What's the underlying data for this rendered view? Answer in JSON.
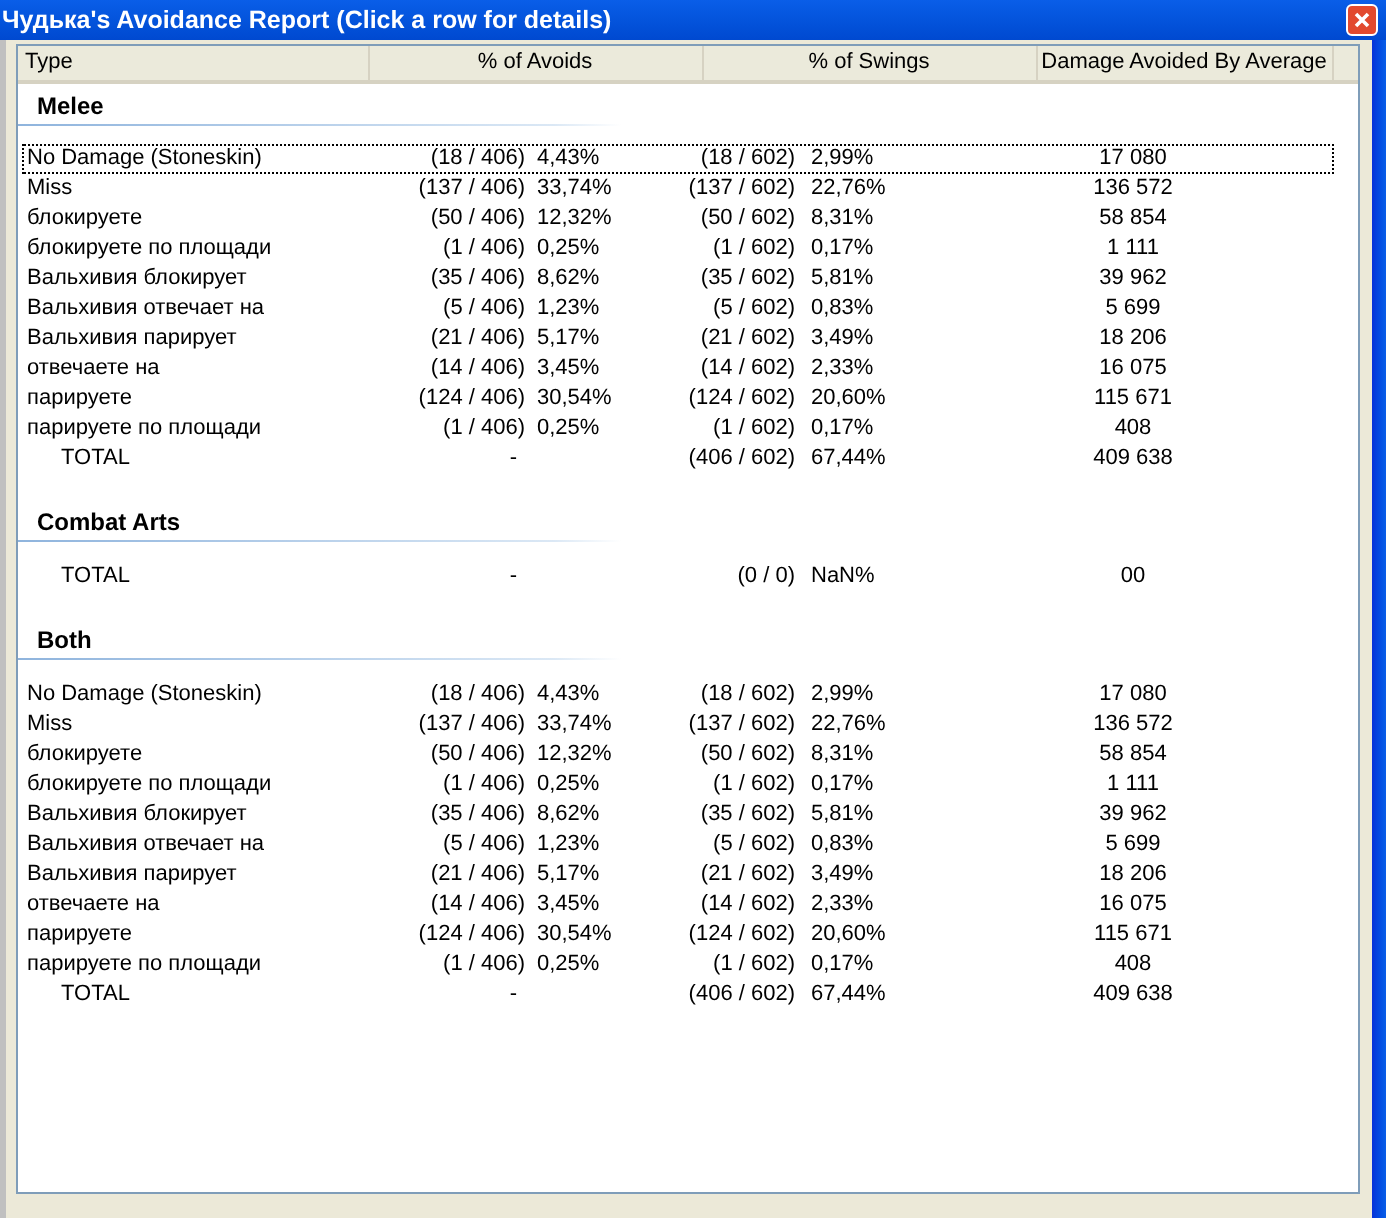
{
  "window": {
    "title": "Чудька's Avoidance Report  (Click a row for details)"
  },
  "table": {
    "columns": [
      "Type",
      "% of Avoids",
      "% of Swings",
      "Damage Avoided By Average"
    ],
    "sections": [
      {
        "title": "Melee",
        "rows": [
          {
            "kind": "item",
            "type": "No Damage (Stoneskin)",
            "avoids": {
              "fraction": "(18 / 406)",
              "percent": "4,43%"
            },
            "swings": {
              "fraction": "(18 / 602)",
              "percent": "2,99%"
            },
            "damage": "17 080",
            "focused": true
          },
          {
            "kind": "item",
            "type": "Miss",
            "avoids": {
              "fraction": "(137 / 406)",
              "percent": "33,74%"
            },
            "swings": {
              "fraction": "(137 / 602)",
              "percent": "22,76%"
            },
            "damage": "136 572",
            "focused": false
          },
          {
            "kind": "item",
            "type": "блокируете",
            "avoids": {
              "fraction": "(50 / 406)",
              "percent": "12,32%"
            },
            "swings": {
              "fraction": "(50 / 602)",
              "percent": "8,31%"
            },
            "damage": "58 854",
            "focused": false
          },
          {
            "kind": "item",
            "type": "блокируете по площади",
            "avoids": {
              "fraction": "(1 / 406)",
              "percent": "0,25%"
            },
            "swings": {
              "fraction": "(1 / 602)",
              "percent": "0,17%"
            },
            "damage": "1 111",
            "focused": false
          },
          {
            "kind": "item",
            "type": "Вальхивия блокирует",
            "avoids": {
              "fraction": "(35 / 406)",
              "percent": "8,62%"
            },
            "swings": {
              "fraction": "(35 / 602)",
              "percent": "5,81%"
            },
            "damage": "39 962",
            "focused": false
          },
          {
            "kind": "item",
            "type": "Вальхивия отвечает на",
            "avoids": {
              "fraction": "(5 / 406)",
              "percent": "1,23%"
            },
            "swings": {
              "fraction": "(5 / 602)",
              "percent": "0,83%"
            },
            "damage": "5 699",
            "focused": false
          },
          {
            "kind": "item",
            "type": "Вальхивия парирует",
            "avoids": {
              "fraction": "(21 / 406)",
              "percent": "5,17%"
            },
            "swings": {
              "fraction": "(21 / 602)",
              "percent": "3,49%"
            },
            "damage": "18 206",
            "focused": false
          },
          {
            "kind": "item",
            "type": "отвечаете на",
            "avoids": {
              "fraction": "(14 / 406)",
              "percent": "3,45%"
            },
            "swings": {
              "fraction": "(14 / 602)",
              "percent": "2,33%"
            },
            "damage": "16 075",
            "focused": false
          },
          {
            "kind": "item",
            "type": "парируете",
            "avoids": {
              "fraction": "(124 / 406)",
              "percent": "30,54%"
            },
            "swings": {
              "fraction": "(124 / 602)",
              "percent": "20,60%"
            },
            "damage": "115 671",
            "focused": false
          },
          {
            "kind": "item",
            "type": "парируете по площади",
            "avoids": {
              "fraction": "(1 / 406)",
              "percent": "0,25%"
            },
            "swings": {
              "fraction": "(1 / 602)",
              "percent": "0,17%"
            },
            "damage": "408",
            "focused": false
          },
          {
            "kind": "total",
            "type": "TOTAL",
            "avoids": {
              "fraction": "-"
            },
            "swings": {
              "fraction": "(406 / 602)",
              "percent": "67,44%"
            },
            "damage": "409 638",
            "focused": false
          }
        ]
      },
      {
        "title": "Combat Arts",
        "rows": [
          {
            "kind": "total",
            "type": "TOTAL",
            "avoids": {
              "fraction": "-"
            },
            "swings": {
              "fraction": "(0 / 0)",
              "percent": "NaN%"
            },
            "damage": "00",
            "focused": false
          }
        ]
      },
      {
        "title": "Both",
        "rows": [
          {
            "kind": "item",
            "type": "No Damage (Stoneskin)",
            "avoids": {
              "fraction": "(18 / 406)",
              "percent": "4,43%"
            },
            "swings": {
              "fraction": "(18 / 602)",
              "percent": "2,99%"
            },
            "damage": "17 080",
            "focused": false
          },
          {
            "kind": "item",
            "type": "Miss",
            "avoids": {
              "fraction": "(137 / 406)",
              "percent": "33,74%"
            },
            "swings": {
              "fraction": "(137 / 602)",
              "percent": "22,76%"
            },
            "damage": "136 572",
            "focused": false
          },
          {
            "kind": "item",
            "type": "блокируете",
            "avoids": {
              "fraction": "(50 / 406)",
              "percent": "12,32%"
            },
            "swings": {
              "fraction": "(50 / 602)",
              "percent": "8,31%"
            },
            "damage": "58 854",
            "focused": false
          },
          {
            "kind": "item",
            "type": "блокируете по площади",
            "avoids": {
              "fraction": "(1 / 406)",
              "percent": "0,25%"
            },
            "swings": {
              "fraction": "(1 / 602)",
              "percent": "0,17%"
            },
            "damage": "1 111",
            "focused": false
          },
          {
            "kind": "item",
            "type": "Вальхивия блокирует",
            "avoids": {
              "fraction": "(35 / 406)",
              "percent": "8,62%"
            },
            "swings": {
              "fraction": "(35 / 602)",
              "percent": "5,81%"
            },
            "damage": "39 962",
            "focused": false
          },
          {
            "kind": "item",
            "type": "Вальхивия отвечает на",
            "avoids": {
              "fraction": "(5 / 406)",
              "percent": "1,23%"
            },
            "swings": {
              "fraction": "(5 / 602)",
              "percent": "0,83%"
            },
            "damage": "5 699",
            "focused": false
          },
          {
            "kind": "item",
            "type": "Вальхивия парирует",
            "avoids": {
              "fraction": "(21 / 406)",
              "percent": "5,17%"
            },
            "swings": {
              "fraction": "(21 / 602)",
              "percent": "3,49%"
            },
            "damage": "18 206",
            "focused": false
          },
          {
            "kind": "item",
            "type": "отвечаете на",
            "avoids": {
              "fraction": "(14 / 406)",
              "percent": "3,45%"
            },
            "swings": {
              "fraction": "(14 / 602)",
              "percent": "2,33%"
            },
            "damage": "16 075",
            "focused": false
          },
          {
            "kind": "item",
            "type": "парируете",
            "avoids": {
              "fraction": "(124 / 406)",
              "percent": "30,54%"
            },
            "swings": {
              "fraction": "(124 / 602)",
              "percent": "20,60%"
            },
            "damage": "115 671",
            "focused": false
          },
          {
            "kind": "item",
            "type": "парируете по площади",
            "avoids": {
              "fraction": "(1 / 406)",
              "percent": "0,25%"
            },
            "swings": {
              "fraction": "(1 / 602)",
              "percent": "0,17%"
            },
            "damage": "408",
            "focused": false
          },
          {
            "kind": "total",
            "type": "TOTAL",
            "avoids": {
              "fraction": "-"
            },
            "swings": {
              "fraction": "(406 / 602)",
              "percent": "67,44%"
            },
            "damage": "409 638",
            "focused": false
          }
        ]
      }
    ]
  }
}
